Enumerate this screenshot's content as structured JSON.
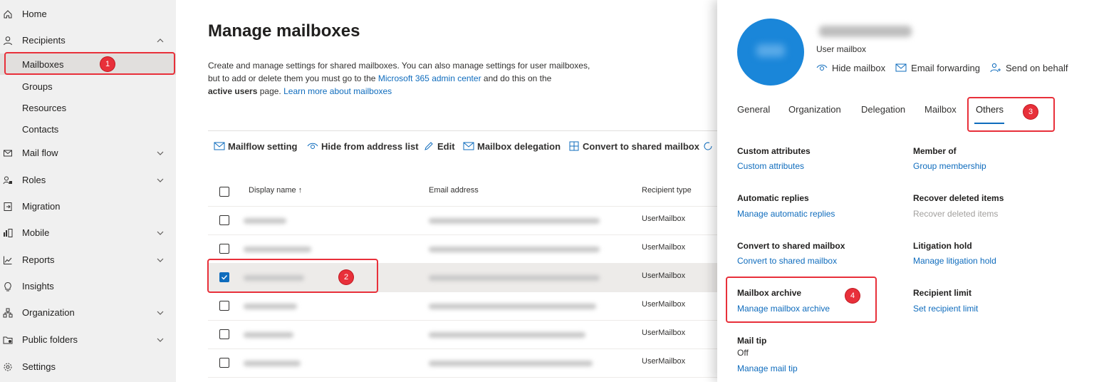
{
  "sidebar": {
    "items": [
      {
        "label": "Home",
        "icon": "home-icon"
      },
      {
        "label": "Recipients",
        "icon": "person-icon"
      },
      {
        "label": "Mail flow",
        "icon": "mail-icon"
      },
      {
        "label": "Roles",
        "icon": "roles-icon"
      },
      {
        "label": "Migration",
        "icon": "migration-icon"
      },
      {
        "label": "Mobile",
        "icon": "mobile-icon"
      },
      {
        "label": "Reports",
        "icon": "chart-icon"
      },
      {
        "label": "Insights",
        "icon": "lightbulb-icon"
      },
      {
        "label": "Organization",
        "icon": "org-icon"
      },
      {
        "label": "Public folders",
        "icon": "folder-icon"
      },
      {
        "label": "Settings",
        "icon": "gear-icon"
      }
    ],
    "recipients_sub": [
      "Mailboxes",
      "Groups",
      "Resources",
      "Contacts"
    ]
  },
  "main": {
    "title": "Manage mailboxes",
    "desc_line1": "Create and manage settings for shared mailboxes. You can also manage settings for user mailboxes,",
    "desc_line2_a": "but to add or delete them you must go to the ",
    "desc_line2_link": "Microsoft 365 admin center",
    "desc_line2_b": " and do this on the",
    "desc_line3_bold": "active users",
    "desc_line3_a": " page. ",
    "desc_line3_link": "Learn more about mailboxes",
    "toolbar": {
      "mailflow": "Mailflow setting",
      "hide": "Hide from address list",
      "edit": "Edit",
      "delegation": "Mailbox delegation",
      "convert": "Convert to shared mailbox"
    },
    "columns": {
      "display_name": "Display name ↑",
      "email": "Email address",
      "type": "Recipient type"
    },
    "rows": [
      {
        "type": "UserMailbox"
      },
      {
        "type": "UserMailbox"
      },
      {
        "type": "UserMailbox"
      },
      {
        "type": "UserMailbox"
      },
      {
        "type": "UserMailbox"
      },
      {
        "type": "UserMailbox"
      }
    ]
  },
  "panel": {
    "user_type": "User mailbox",
    "actions": {
      "hide": "Hide mailbox",
      "forward": "Email forwarding",
      "behalf": "Send on behalf"
    },
    "tabs": [
      "General",
      "Organization",
      "Delegation",
      "Mailbox",
      "Others"
    ],
    "sections": {
      "custom_title": "Custom attributes",
      "custom_link": "Custom attributes",
      "member_title": "Member of",
      "member_link": "Group membership",
      "auto_title": "Automatic replies",
      "auto_link": "Manage automatic replies",
      "recover_title": "Recover deleted items",
      "recover_link": "Recover deleted items",
      "convert_title": "Convert to shared mailbox",
      "convert_link": "Convert to shared mailbox",
      "litigation_title": "Litigation hold",
      "litigation_link": "Manage litigation hold",
      "archive_title": "Mailbox archive",
      "archive_link": "Manage mailbox archive",
      "limit_title": "Recipient limit",
      "limit_link": "Set recipient limit",
      "mailtip_title": "Mail tip",
      "mailtip_value": "Off",
      "mailtip_link": "Manage mail tip"
    }
  },
  "callouts": [
    "1",
    "2",
    "3",
    "4"
  ],
  "colors": {
    "accent": "#0f6cbd",
    "callout": "#e8303a",
    "avatar": "#1a86d9"
  }
}
